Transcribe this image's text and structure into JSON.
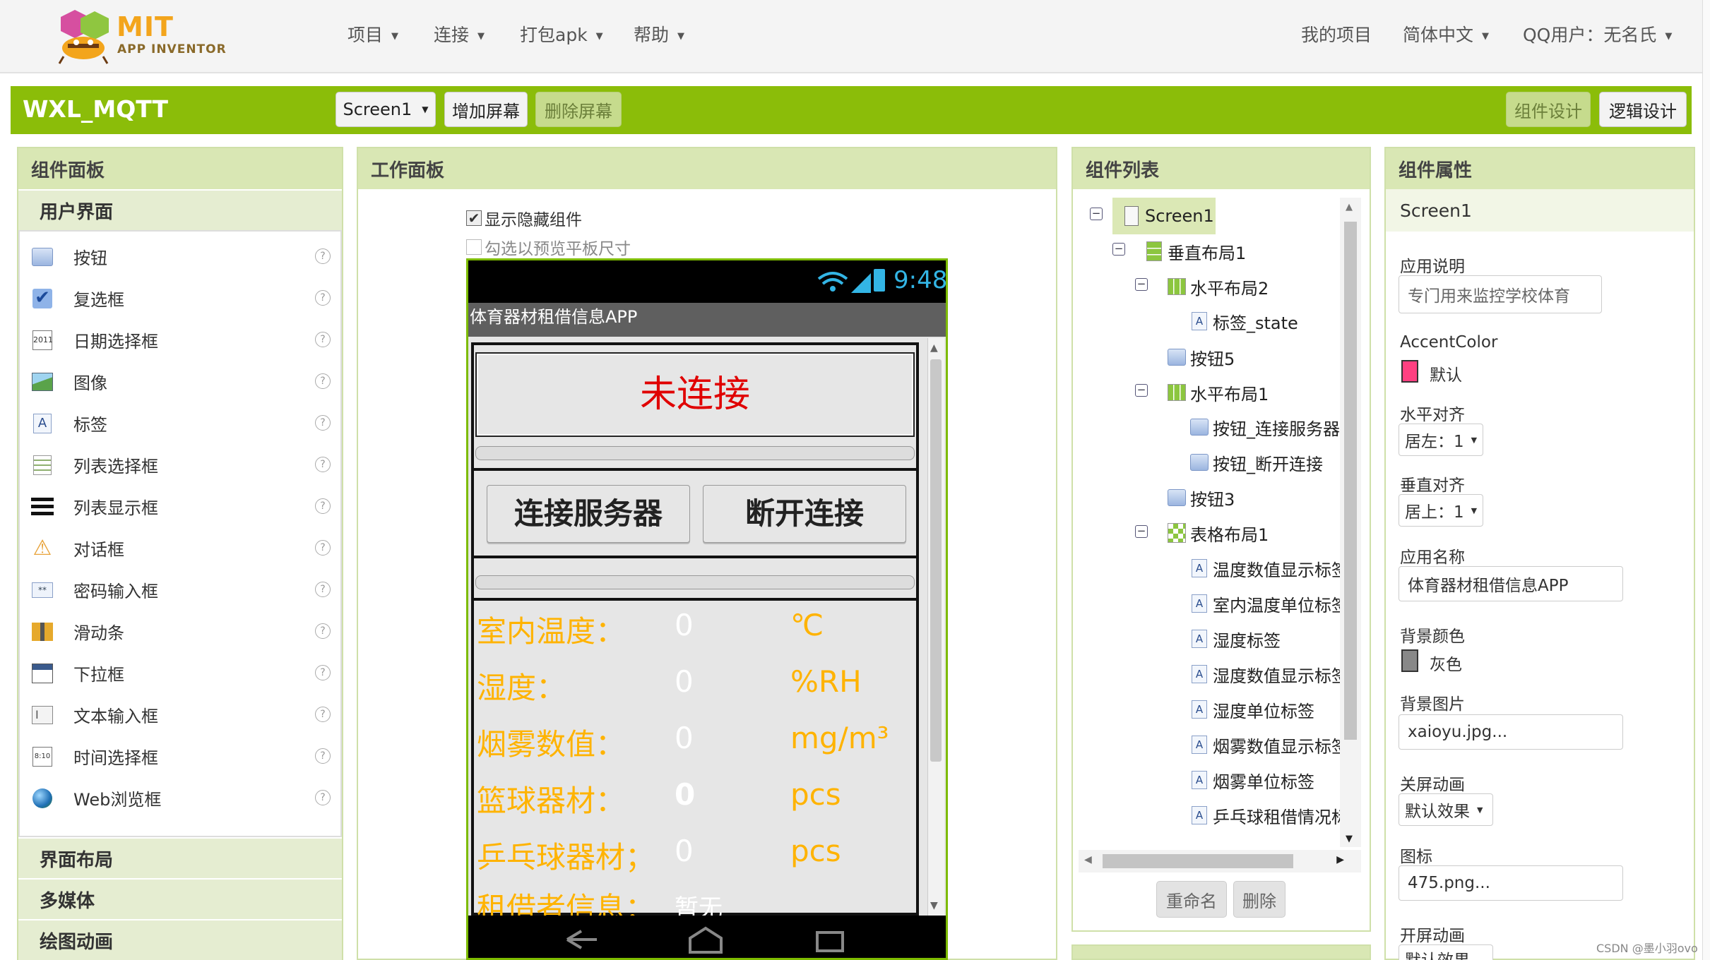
{
  "topbar": {
    "logo_title": "MIT",
    "logo_sub": "APP INVENTOR",
    "menus": [
      "项目",
      "连接",
      "打包apk",
      "帮助"
    ],
    "right": [
      "我的项目",
      "简体中文",
      "QQ用户：无名氏"
    ]
  },
  "project": {
    "name": "WXL_MQTT",
    "screen_select": "Screen1",
    "add_screen": "增加屏幕",
    "remove_screen": "删除屏幕",
    "designer": "组件设计",
    "blocks": "逻辑设计"
  },
  "palette": {
    "title": "组件面板",
    "section_user": "用户界面",
    "items": [
      {
        "label": "按钮",
        "icon": "button-icon"
      },
      {
        "label": "复选框",
        "icon": "checkbox-icon"
      },
      {
        "label": "日期选择框",
        "icon": "datepicker-icon"
      },
      {
        "label": "图像",
        "icon": "image-icon"
      },
      {
        "label": "标签",
        "icon": "label-icon"
      },
      {
        "label": "列表选择框",
        "icon": "listpicker-icon"
      },
      {
        "label": "列表显示框",
        "icon": "listview-icon"
      },
      {
        "label": "对话框",
        "icon": "notifier-icon"
      },
      {
        "label": "密码输入框",
        "icon": "password-icon"
      },
      {
        "label": "滑动条",
        "icon": "slider-icon"
      },
      {
        "label": "下拉框",
        "icon": "spinner-icon"
      },
      {
        "label": "文本输入框",
        "icon": "textbox-icon"
      },
      {
        "label": "时间选择框",
        "icon": "timepicker-icon"
      },
      {
        "label": "Web浏览框",
        "icon": "webviewer-icon"
      }
    ],
    "help": "?",
    "section_layout": "界面布局",
    "section_media": "多媒体",
    "section_draw": "绘图动画"
  },
  "viewer": {
    "title": "工作面板",
    "show_hidden": "显示隐藏组件",
    "tablet_preview": "勾选以预览平板尺寸",
    "status_time": "9:48",
    "app_title": "体育器材租借信息APP",
    "connection_status": "未连接",
    "btn_connect": "连接服务器",
    "btn_disconnect": "断开连接",
    "rows": [
      {
        "label": "室内温度：",
        "value": "0",
        "unit": "℃"
      },
      {
        "label": "湿度：",
        "value": "0",
        "unit": "%RH"
      },
      {
        "label": "烟雾数值：",
        "value": "0",
        "unit": "mg/m³"
      },
      {
        "label": "篮球器材：",
        "value": "0",
        "unit": "pcs"
      },
      {
        "label": "乒乓球器材；",
        "value": "0",
        "unit": "pcs"
      }
    ],
    "renter_label": "租借者信息：",
    "renter_value": "暂无"
  },
  "components": {
    "title": "组件列表",
    "tree": [
      {
        "label": "Screen1",
        "icon": "screen-icon"
      },
      {
        "label": "垂直布局1",
        "icon": "vertical-layout-icon"
      },
      {
        "label": "水平布局2",
        "icon": "horizontal-layout-icon"
      },
      {
        "label": "标签_state",
        "icon": "label-icon"
      },
      {
        "label": "按钮5",
        "icon": "button-icon"
      },
      {
        "label": "水平布局1",
        "icon": "horizontal-layout-icon"
      },
      {
        "label": "按钮_连接服务器",
        "icon": "button-icon"
      },
      {
        "label": "按钮_断开连接",
        "icon": "button-icon"
      },
      {
        "label": "按钮3",
        "icon": "button-icon"
      },
      {
        "label": "表格布局1",
        "icon": "table-layout-icon"
      },
      {
        "label": "温度数值显示标签",
        "icon": "label-icon"
      },
      {
        "label": "室内温度单位标签",
        "icon": "label-icon"
      },
      {
        "label": "湿度标签",
        "icon": "label-icon"
      },
      {
        "label": "湿度数值显示标签",
        "icon": "label-icon"
      },
      {
        "label": "湿度单位标签",
        "icon": "label-icon"
      },
      {
        "label": "烟雾数值显示标签",
        "icon": "label-icon"
      },
      {
        "label": "烟雾单位标签",
        "icon": "label-icon"
      },
      {
        "label": "乒乓球租借情况标签",
        "icon": "label-icon"
      }
    ],
    "rename": "重命名",
    "delete": "删除"
  },
  "properties": {
    "title": "组件属性",
    "component": "Screen1",
    "about_label": "应用说明",
    "about_value": "专门用来监控学校体育",
    "accent_label": "AccentColor",
    "accent_value": "默认",
    "accent_color": "#ff4081",
    "halign_label": "水平对齐",
    "halign_value": "居左：1",
    "valign_label": "垂直对齐",
    "valign_value": "居上：1",
    "appname_label": "应用名称",
    "appname_value": "体育器材租借信息APP",
    "bgcolor_label": "背景颜色",
    "bgcolor_value": "灰色",
    "bgcolor_color": "#888888",
    "bgimage_label": "背景图片",
    "bgimage_value": "xaioyu.jpg...",
    "close_anim_label": "关屏动画",
    "close_anim_value": "默认效果",
    "icon_label": "图标",
    "icon_value": "475.png...",
    "open_anim_label": "开屏动画",
    "open_anim_value": "默认效果"
  },
  "watermark": "CSDN @墨小羽ovo"
}
